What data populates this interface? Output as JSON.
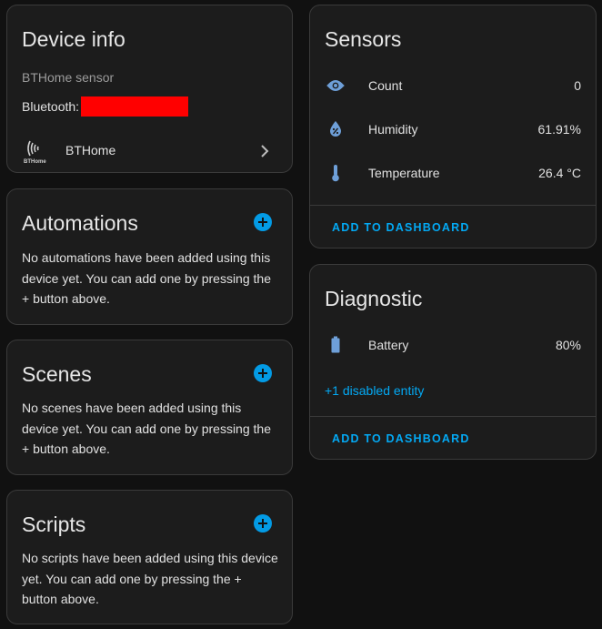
{
  "device_info": {
    "title": "Device info",
    "model": "BTHome sensor",
    "bluetooth_label": "Bluetooth:",
    "bluetooth_redaction_color": "#ff0000",
    "integration_logo_text": "BTHome",
    "integration_name": "BTHome"
  },
  "automations": {
    "title": "Automations",
    "empty_text": "No automations have been added using this device yet. You can add one by pressing the + button above."
  },
  "scenes": {
    "title": "Scenes",
    "empty_text": "No scenes have been added using this device yet. You can add one by pressing the + button above."
  },
  "scripts": {
    "title": "Scripts",
    "empty_text": "No scripts have been added using this device yet. You can add one by pressing the + button above."
  },
  "sensors": {
    "title": "Sensors",
    "entities": [
      {
        "name": "Count",
        "state": "0",
        "icon": "eye-icon"
      },
      {
        "name": "Humidity",
        "state": "61.91%",
        "icon": "water-percent-icon"
      },
      {
        "name": "Temperature",
        "state": "26.4 °C",
        "icon": "thermometer-icon"
      }
    ],
    "action": "ADD TO DASHBOARD"
  },
  "diagnostic": {
    "title": "Diagnostic",
    "entities": [
      {
        "name": "Battery",
        "state": "80%",
        "icon": "battery-icon"
      }
    ],
    "disabled_link": "+1 disabled entity",
    "action": "ADD TO DASHBOARD"
  },
  "colors": {
    "accent": "#03a9f4",
    "icon": "#6e9fd8",
    "card_bg": "#1c1c1c",
    "page_bg": "#111111"
  }
}
